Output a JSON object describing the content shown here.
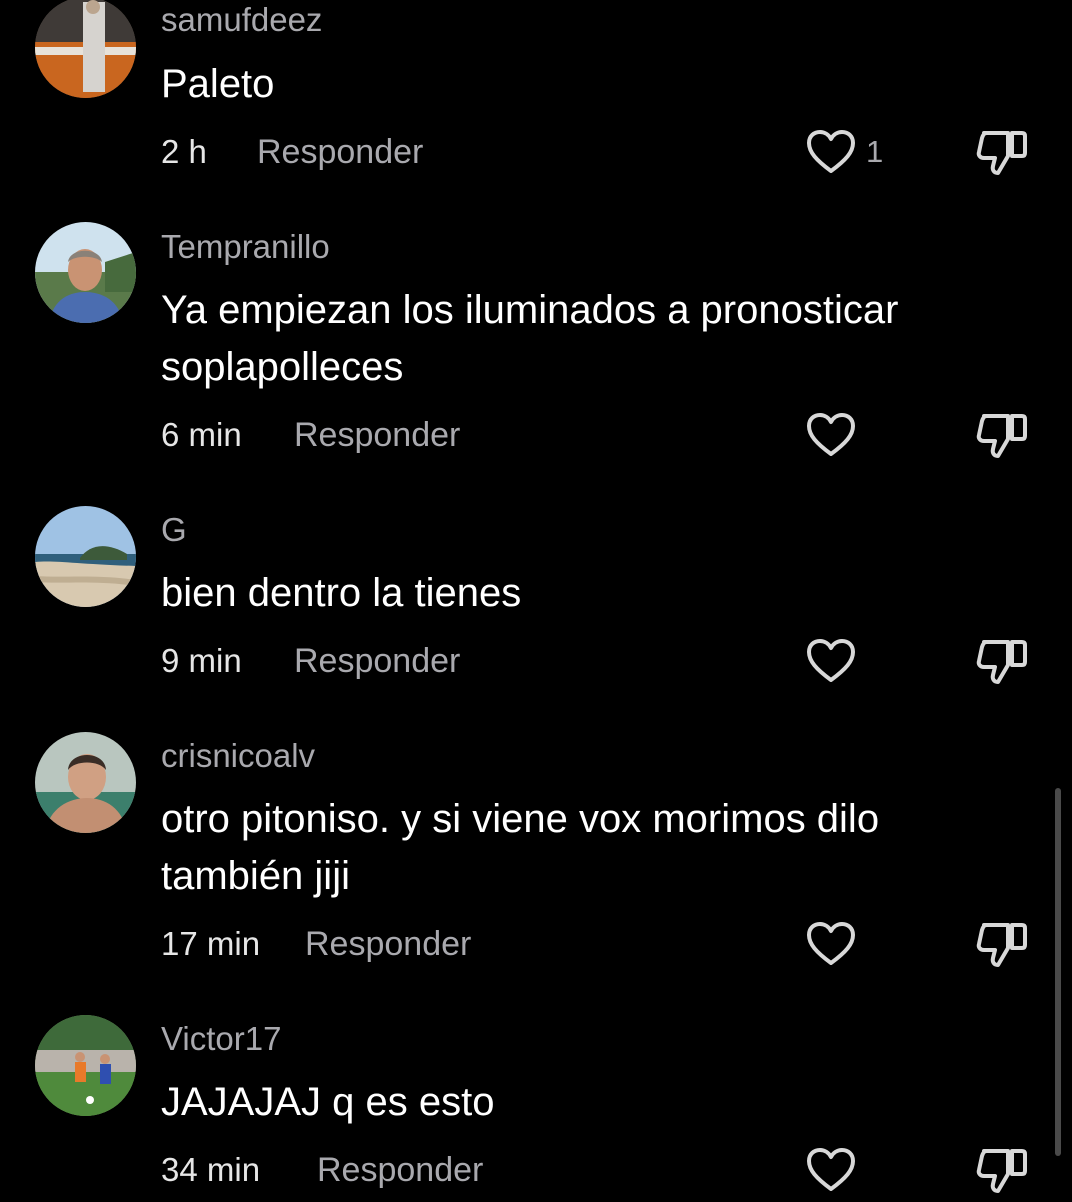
{
  "comments": [
    {
      "username": "samufdeez",
      "text": "Paleto",
      "time": "2 h",
      "reply_label": "Responder",
      "like_count": "1",
      "avatar_icon": "user-avatar-photo-room"
    },
    {
      "username": "Tempranillo",
      "text": "Ya empiezan los iluminados a pronosticar soplapolleces",
      "time": "6 min",
      "reply_label": "Responder",
      "like_count": "",
      "avatar_icon": "user-avatar-photo-man"
    },
    {
      "username": "G",
      "text": "bien dentro la tienes",
      "time": "9 min",
      "reply_label": "Responder",
      "like_count": "",
      "avatar_icon": "user-avatar-photo-beach"
    },
    {
      "username": "crisnicoalv",
      "text": "otro pitoniso. y si viene vox morimos dilo también jiji",
      "time": "17 min",
      "reply_label": "Responder",
      "like_count": "",
      "avatar_icon": "user-avatar-photo-man"
    },
    {
      "username": "Victor17",
      "text": "JAJAJAJ q es esto",
      "time": "34 min",
      "reply_label": "Responder",
      "like_count": "",
      "avatar_icon": "user-avatar-photo-football"
    }
  ],
  "colors": {
    "background": "#000000",
    "secondary_text": "#a9a9ae",
    "primary_text": "#ffffff"
  }
}
